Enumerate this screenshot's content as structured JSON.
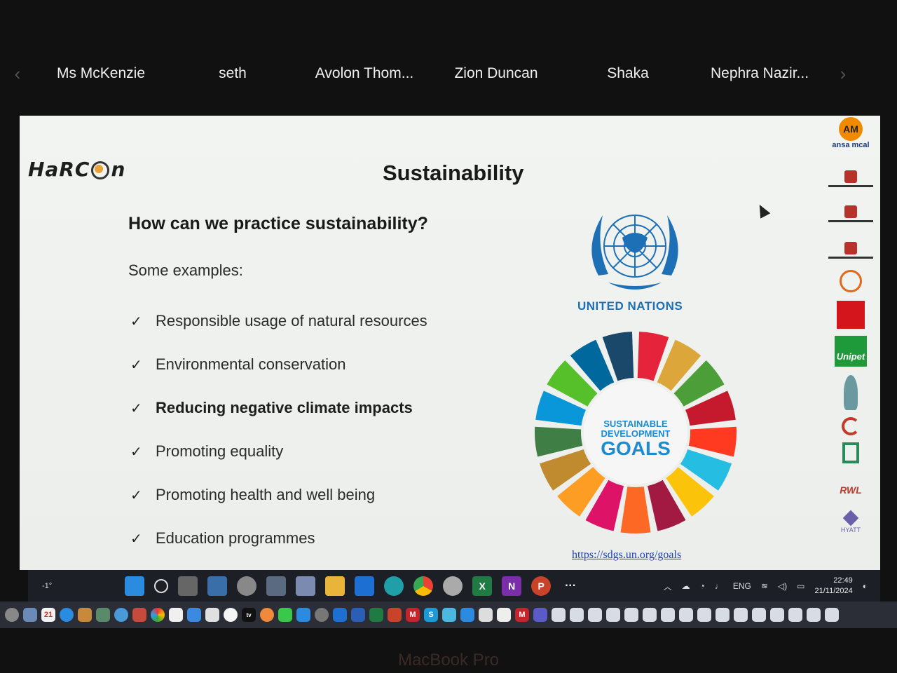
{
  "participants": {
    "prev_icon": "chevron-left-icon",
    "next_icon": "chevron-right-icon",
    "names": [
      "Ms McKenzie",
      "seth",
      "Avolon Thom...",
      "Zion Duncan",
      "Shaka",
      "Nephra Nazir..."
    ]
  },
  "slide": {
    "logo_text": "HaRC",
    "logo_text2": "n",
    "title": "Sustainability",
    "question": "How can we practice sustainability?",
    "examples_label": "Some examples:",
    "bullets": [
      "Responsible usage of natural resources",
      "Environmental conservation",
      "Reducing negative climate impacts",
      "Promoting equality",
      "Promoting health and well being",
      "Education programmes"
    ],
    "un_label": "UNITED NATIONS",
    "sdg_line1": "SUSTAINABLE",
    "sdg_line2": "DEVELOPMENT",
    "sdg_line3": "GOALS",
    "link": "https://sdgs.un.org/goals",
    "sponsors": {
      "ansa": "ansa mcal",
      "unipet": "Unipet",
      "rwl": "RWL",
      "hyatt": "HYATT"
    }
  },
  "taskbar": {
    "weather": "-1°",
    "lang": "ENG",
    "time": "22:49",
    "date": "21/11/2024"
  },
  "dock": {
    "calendar_day": "21",
    "appletv": "tv"
  },
  "footer": "MacBook Pro",
  "colors": {
    "un_blue": "#1d6fb6",
    "sdg": [
      "#e5243b",
      "#dda63a",
      "#4c9f38",
      "#c5192d",
      "#ff3a21",
      "#26bde2",
      "#fcc30b",
      "#a21942",
      "#fd6925",
      "#dd1367",
      "#fd9d24",
      "#bf8b2e",
      "#3f7e44",
      "#0a97d9",
      "#56c02b",
      "#00689d",
      "#19486a"
    ]
  }
}
